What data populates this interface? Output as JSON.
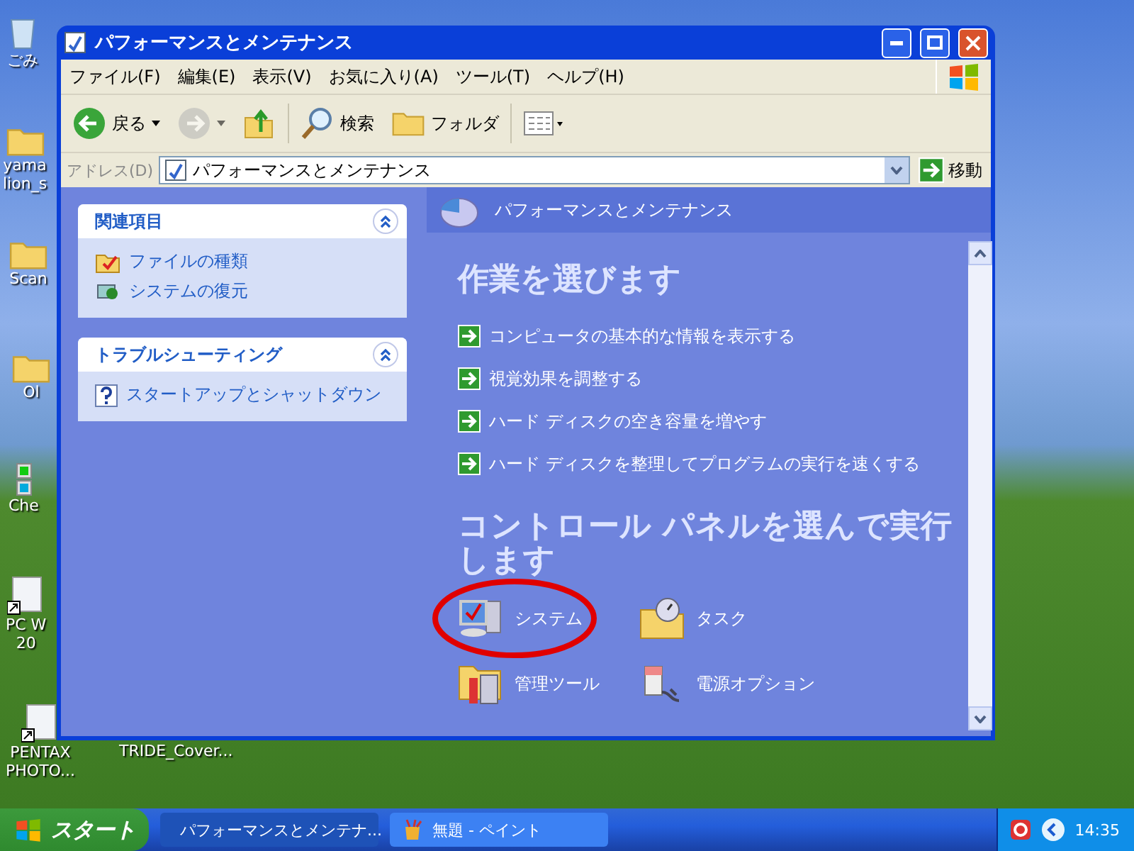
{
  "desktop_icons": [
    {
      "kind": "recycle",
      "lines": [
        "ごみ"
      ]
    },
    {
      "kind": "folder",
      "lines": [
        "yama",
        "lion_s"
      ]
    },
    {
      "kind": "folder",
      "lines": [
        "Scan"
      ]
    },
    {
      "kind": "folder",
      "lines": [
        "Ol"
      ]
    },
    {
      "kind": "app",
      "lines": [
        "Che"
      ]
    },
    {
      "kind": "shortcut",
      "lines": [
        "PC W",
        "20"
      ]
    },
    {
      "kind": "shortcut",
      "lines": [
        "PENTAX",
        "PHOTO..."
      ]
    },
    {
      "kind": "blank",
      "lines": [
        "TRIDE_Cover..."
      ]
    }
  ],
  "window": {
    "title": "パフォーマンスとメンテナンス"
  },
  "menu": [
    "ファイル(F)",
    "編集(E)",
    "表示(V)",
    "お気に入り(A)",
    "ツール(T)",
    "ヘルプ(H)"
  ],
  "toolbar": [
    {
      "kind": "back",
      "label": "戻る",
      "disabled": false
    },
    {
      "kind": "forward",
      "disabled": true
    },
    {
      "kind": "up",
      "disabled": false
    },
    {
      "kind": "search",
      "label": "検索",
      "disabled": false
    },
    {
      "kind": "folders",
      "label": "フォルダ",
      "disabled": false
    },
    {
      "kind": "views",
      "disabled": false
    }
  ],
  "address": {
    "label": "アドレス(D)",
    "value": "パフォーマンスとメンテナンス",
    "go": "移動"
  },
  "side_panels": [
    {
      "title": "関連項目",
      "expanded": true,
      "items": [
        {
          "kind": "filetypes",
          "label": "ファイルの種類"
        },
        {
          "kind": "restore",
          "label": "システムの復元"
        }
      ]
    },
    {
      "title": "トラブルシューティング",
      "expanded": true,
      "items": [
        {
          "kind": "help",
          "label": "スタートアップとシャットダウン"
        }
      ]
    }
  ],
  "content": {
    "header": "パフォーマンスとメンテナンス",
    "task_heading": "作業を選びます",
    "tasks": [
      "コンピュータの基本的な情報を表示する",
      "視覚効果を調整する",
      "ハード ディスクの空き容量を増やす",
      "ハード ディスクを整理してプログラムの実行を速くする"
    ],
    "panel_heading": "コントロール パネルを選んで実行します",
    "panel_items": [
      {
        "kind": "system",
        "label": "システム",
        "highlighted": true
      },
      {
        "kind": "tasks",
        "label": "タスク",
        "highlighted": false
      },
      {
        "kind": "admin",
        "label": "管理ツール",
        "highlighted": false
      },
      {
        "kind": "power",
        "label": "電源オプション",
        "highlighted": false
      }
    ]
  },
  "taskbar": {
    "start": "スタート",
    "tasks": [
      {
        "kind": "explorer",
        "label": "パフォーマンスとメンテナ...",
        "selected": true
      },
      {
        "kind": "paint",
        "label": "無題 - ペイント",
        "selected": false
      }
    ],
    "clock": "14:35"
  }
}
